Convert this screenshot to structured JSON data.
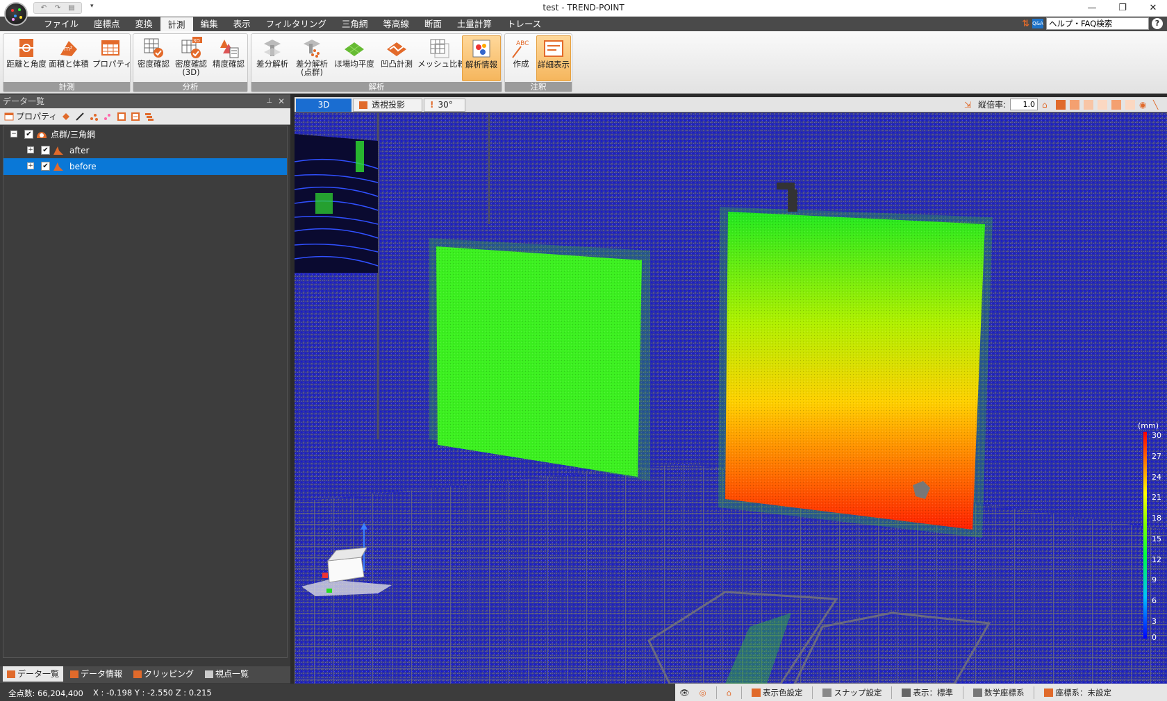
{
  "app": {
    "title": "test - TREND-POINT"
  },
  "window_controls": {
    "minimize": "—",
    "restore": "❐",
    "close": "✕"
  },
  "qat": {
    "more": "▾"
  },
  "menu": {
    "tabs": [
      "ファイル",
      "座標点",
      "変換",
      "計測",
      "編集",
      "表示",
      "フィルタリング",
      "三角網",
      "等高線",
      "断面",
      "土量計算",
      "トレース"
    ],
    "active": "計測"
  },
  "help": {
    "search_value": "ヘルプ・FAQ検索",
    "qa_label": "Q&A",
    "help_icon": "?"
  },
  "ribbon": {
    "groups": [
      {
        "label": "計測",
        "buttons": [
          "距離と角度",
          "面積と体積",
          "プロパティ"
        ]
      },
      {
        "label": "分析",
        "buttons": [
          "密度確認",
          "密度確認\n(3D)",
          "精度確認"
        ]
      },
      {
        "label": "解析",
        "buttons": [
          "差分解析",
          "差分解析\n(点群)",
          "ほ場均平度",
          "凹凸計測",
          "メッシュ比較",
          "解析情報"
        ]
      },
      {
        "label": "注釈",
        "buttons": [
          "作成",
          "詳細表示"
        ]
      }
    ],
    "icon_badges": {
      "area_unit": "m²",
      "density3d": "3D",
      "annotation": "ABC"
    }
  },
  "left_panel": {
    "title": "データ一覧",
    "pin_icon": "⊥",
    "close_icon": "✕",
    "toolbar": {
      "properties_label": "プロパティ"
    },
    "tree": {
      "root": {
        "label": "点群/三角網",
        "expander": "−",
        "checked": true
      },
      "children": [
        {
          "label": "after",
          "expander": "+",
          "checked": true,
          "selected": false
        },
        {
          "label": "before",
          "expander": "+",
          "checked": true,
          "selected": true
        }
      ]
    },
    "tabs": [
      "データ一覧",
      "データ情報",
      "クリッピング",
      "視点一覧"
    ],
    "active_tab": "データ一覧"
  },
  "viewport": {
    "tab_3d": "3D",
    "projection": "透視投影",
    "angle": "30°",
    "vscale_label": "縦倍率:",
    "vscale_value": "1.0",
    "legend": {
      "unit": "(mm)",
      "ticks": [
        "30",
        "27",
        "24",
        "21",
        "18",
        "15",
        "12",
        "9",
        "6",
        "3",
        "0"
      ],
      "min": 0,
      "max": 30
    }
  },
  "status": {
    "point_count": "全点数: 66,204,400",
    "coords": "X : -0.198  Y : -2.550  Z : 0.215",
    "items": [
      "表示色設定",
      "スナップ設定",
      "表示：標準",
      "数学座標系",
      "座標系：未設定"
    ]
  },
  "colors": {
    "accent_orange": "#e06a2b",
    "selection_blue": "#0a78d7",
    "ribbon_highlight": "#f5b65d"
  }
}
